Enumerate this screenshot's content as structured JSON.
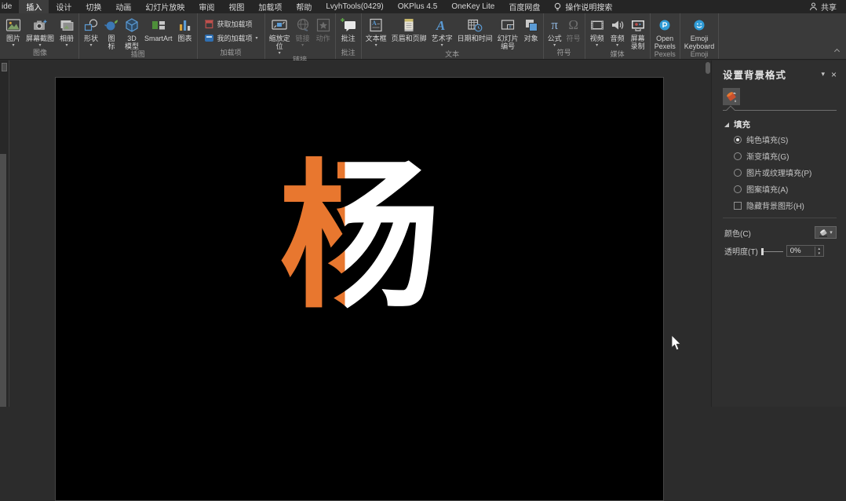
{
  "menu": {
    "tabs": [
      "ide",
      "插入",
      "设计",
      "切换",
      "动画",
      "幻灯片放映",
      "审阅",
      "视图",
      "加载项",
      "帮助",
      "LvyhTools(0429)",
      "OKPlus 4.5",
      "OneKey Lite",
      "百度网盘"
    ],
    "assist_label": "操作说明搜索",
    "share_label": "共享"
  },
  "ribbon": {
    "groups": [
      {
        "label": "图像",
        "buttons": [
          {
            "label": "图片"
          },
          {
            "label": "屏幕截图"
          },
          {
            "label": "相册"
          }
        ]
      },
      {
        "label": "插图",
        "buttons": [
          {
            "label": "形状"
          },
          {
            "label": "图\n标"
          },
          {
            "label": "3D\n模型"
          },
          {
            "label": "SmartArt"
          },
          {
            "label": "图表"
          }
        ]
      },
      {
        "label": "加载项",
        "buttons": [
          {
            "label": "获取加载项"
          },
          {
            "label": "我的加载项"
          }
        ]
      },
      {
        "label": "链接",
        "buttons": [
          {
            "label": "缩放定\n位"
          },
          {
            "label": "链接"
          },
          {
            "label": "动作"
          }
        ]
      },
      {
        "label": "批注",
        "buttons": [
          {
            "label": "批注"
          }
        ]
      },
      {
        "label": "文本",
        "buttons": [
          {
            "label": "文本框"
          },
          {
            "label": "页眉和页脚"
          },
          {
            "label": "艺术字"
          },
          {
            "label": "日期和时间"
          },
          {
            "label": "幻灯片\n编号"
          },
          {
            "label": "对象"
          }
        ]
      },
      {
        "label": "符号",
        "buttons": [
          {
            "label": "公式"
          },
          {
            "label": "符号"
          }
        ]
      },
      {
        "label": "媒体",
        "buttons": [
          {
            "label": "视频"
          },
          {
            "label": "音频"
          },
          {
            "label": "屏幕\n录制"
          }
        ]
      },
      {
        "label": "Pexels",
        "buttons": [
          {
            "label": "Open\nPexels"
          }
        ]
      },
      {
        "label": "Emoji",
        "buttons": [
          {
            "label": "Emoji\nKeyboard"
          }
        ]
      }
    ]
  },
  "slide": {
    "character": "杨",
    "radical_color": "#E8772F",
    "body_color": "#FFFFFF",
    "background_color": "#000000"
  },
  "panel": {
    "title": "设置背景格式",
    "fill_section_label": "填充",
    "options": [
      {
        "label": "纯色填充(S)",
        "type": "radio",
        "checked": true
      },
      {
        "label": "渐变填充(G)",
        "type": "radio",
        "checked": false
      },
      {
        "label": "图片或纹理填充(P)",
        "type": "radio",
        "checked": false
      },
      {
        "label": "图案填充(A)",
        "type": "radio",
        "checked": false
      },
      {
        "label": "隐藏背景图形(H)",
        "type": "checkbox",
        "checked": false
      }
    ],
    "color_label": "颜色(C)",
    "transparency_label": "透明度(T)",
    "transparency_value": "0%"
  }
}
